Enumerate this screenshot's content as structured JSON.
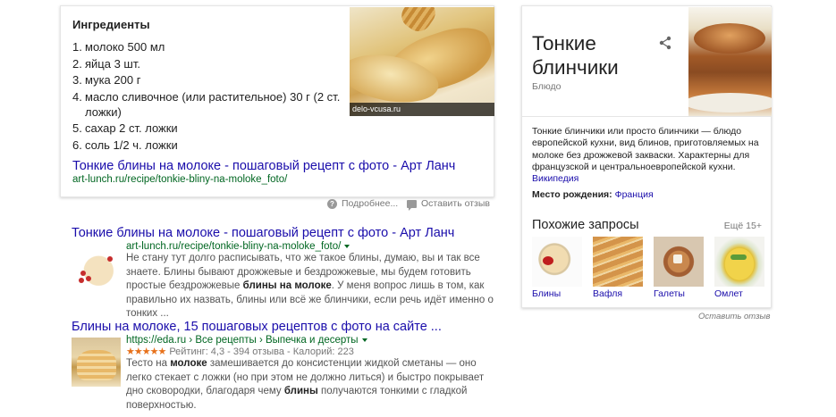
{
  "featured": {
    "heading": "Ингредиенты",
    "ingredients": [
      {
        "num": "1.",
        "text": "молоко 500 мл"
      },
      {
        "num": "2.",
        "text": "яйца 3 шт."
      },
      {
        "num": "3.",
        "text": "мука 200 г"
      },
      {
        "num": "4.",
        "text": "масло сливочное (или растительное) 30 г (2 ст. ложки)"
      },
      {
        "num": "5.",
        "text": "сахар 2 ст. ложки"
      },
      {
        "num": "6.",
        "text": "соль 1/2 ч. ложки"
      }
    ],
    "image_caption": "delo-vcusa.ru",
    "link_title": "Тонкие блины на молоке - пошаговый рецепт с фото - Арт Ланч",
    "link_url": "art-lunch.ru/recipe/tonkie-bliny-na-moloke_foto/",
    "more_label": "Подробнее...",
    "feedback_label": "Оставить отзыв"
  },
  "results": [
    {
      "title": "Тонкие блины на молоке - пошаговый рецепт с фото - Арт Ланч",
      "url": "art-lunch.ru/recipe/tonkie-bliny-na-moloke_foto/",
      "snippet_1": "Не стану тут долго расписывать, что же такое блины, думаю, вы и так все знаете. Блины бывают дрожжевые и бездрожжевые, мы будем готовить простые бездрожжевые ",
      "snippet_bold": "блины на молоке",
      "snippet_2": ". У меня вопрос лишь в том, как правильно их назвать, блины или всё же блинчики, если речь идёт именно о тонких ..."
    },
    {
      "title": "Блины на молоке, 15 пошаговых рецептов с фото на сайте ...",
      "url": "https://eda.ru › Все рецепты › Выпечка и десерты",
      "stars": "★★★★★",
      "rating": "Рейтинг: 4,3 - 394 отзыва - Калорий: 223",
      "snippet_1": "Тесто на ",
      "snippet_bold_1": "молоке",
      "snippet_2": " замешивается до консистенции жидкой сметаны — оно легко стекает с ложки (но при этом не должно литься) и быстро покрывает дно сковородки, благодаря чему ",
      "snippet_bold_2": "блины",
      "snippet_3": " получаются тонкими с гладкой поверхностью."
    }
  ],
  "knowledge_panel": {
    "title": "Тонкие блинчики",
    "subtitle": "Блюдо",
    "description": "Тонкие блинчики или просто блинчики — блюдо европейской кухни, вид блинов, приготовляемых на молоке без дрожжевой закваски. Характерны для французской и центральноевропейской кухни.",
    "source_link": "Википедия",
    "birthplace_label": "Место рождения:",
    "birthplace_value": "Франция",
    "related_heading": "Похожие запросы",
    "related_more": "Ещё 15+",
    "related": [
      {
        "label": "Блины",
        "icon": "blini-image"
      },
      {
        "label": "Вафля",
        "icon": "waffle-image"
      },
      {
        "label": "Галеты",
        "icon": "galette-image"
      },
      {
        "label": "Омлет",
        "icon": "omelet-image"
      }
    ],
    "feedback_label": "Оставить отзыв"
  },
  "colors": {
    "link": "#1a0dab",
    "url": "#006621",
    "snippet": "#545454",
    "stars": "#e7711b"
  }
}
